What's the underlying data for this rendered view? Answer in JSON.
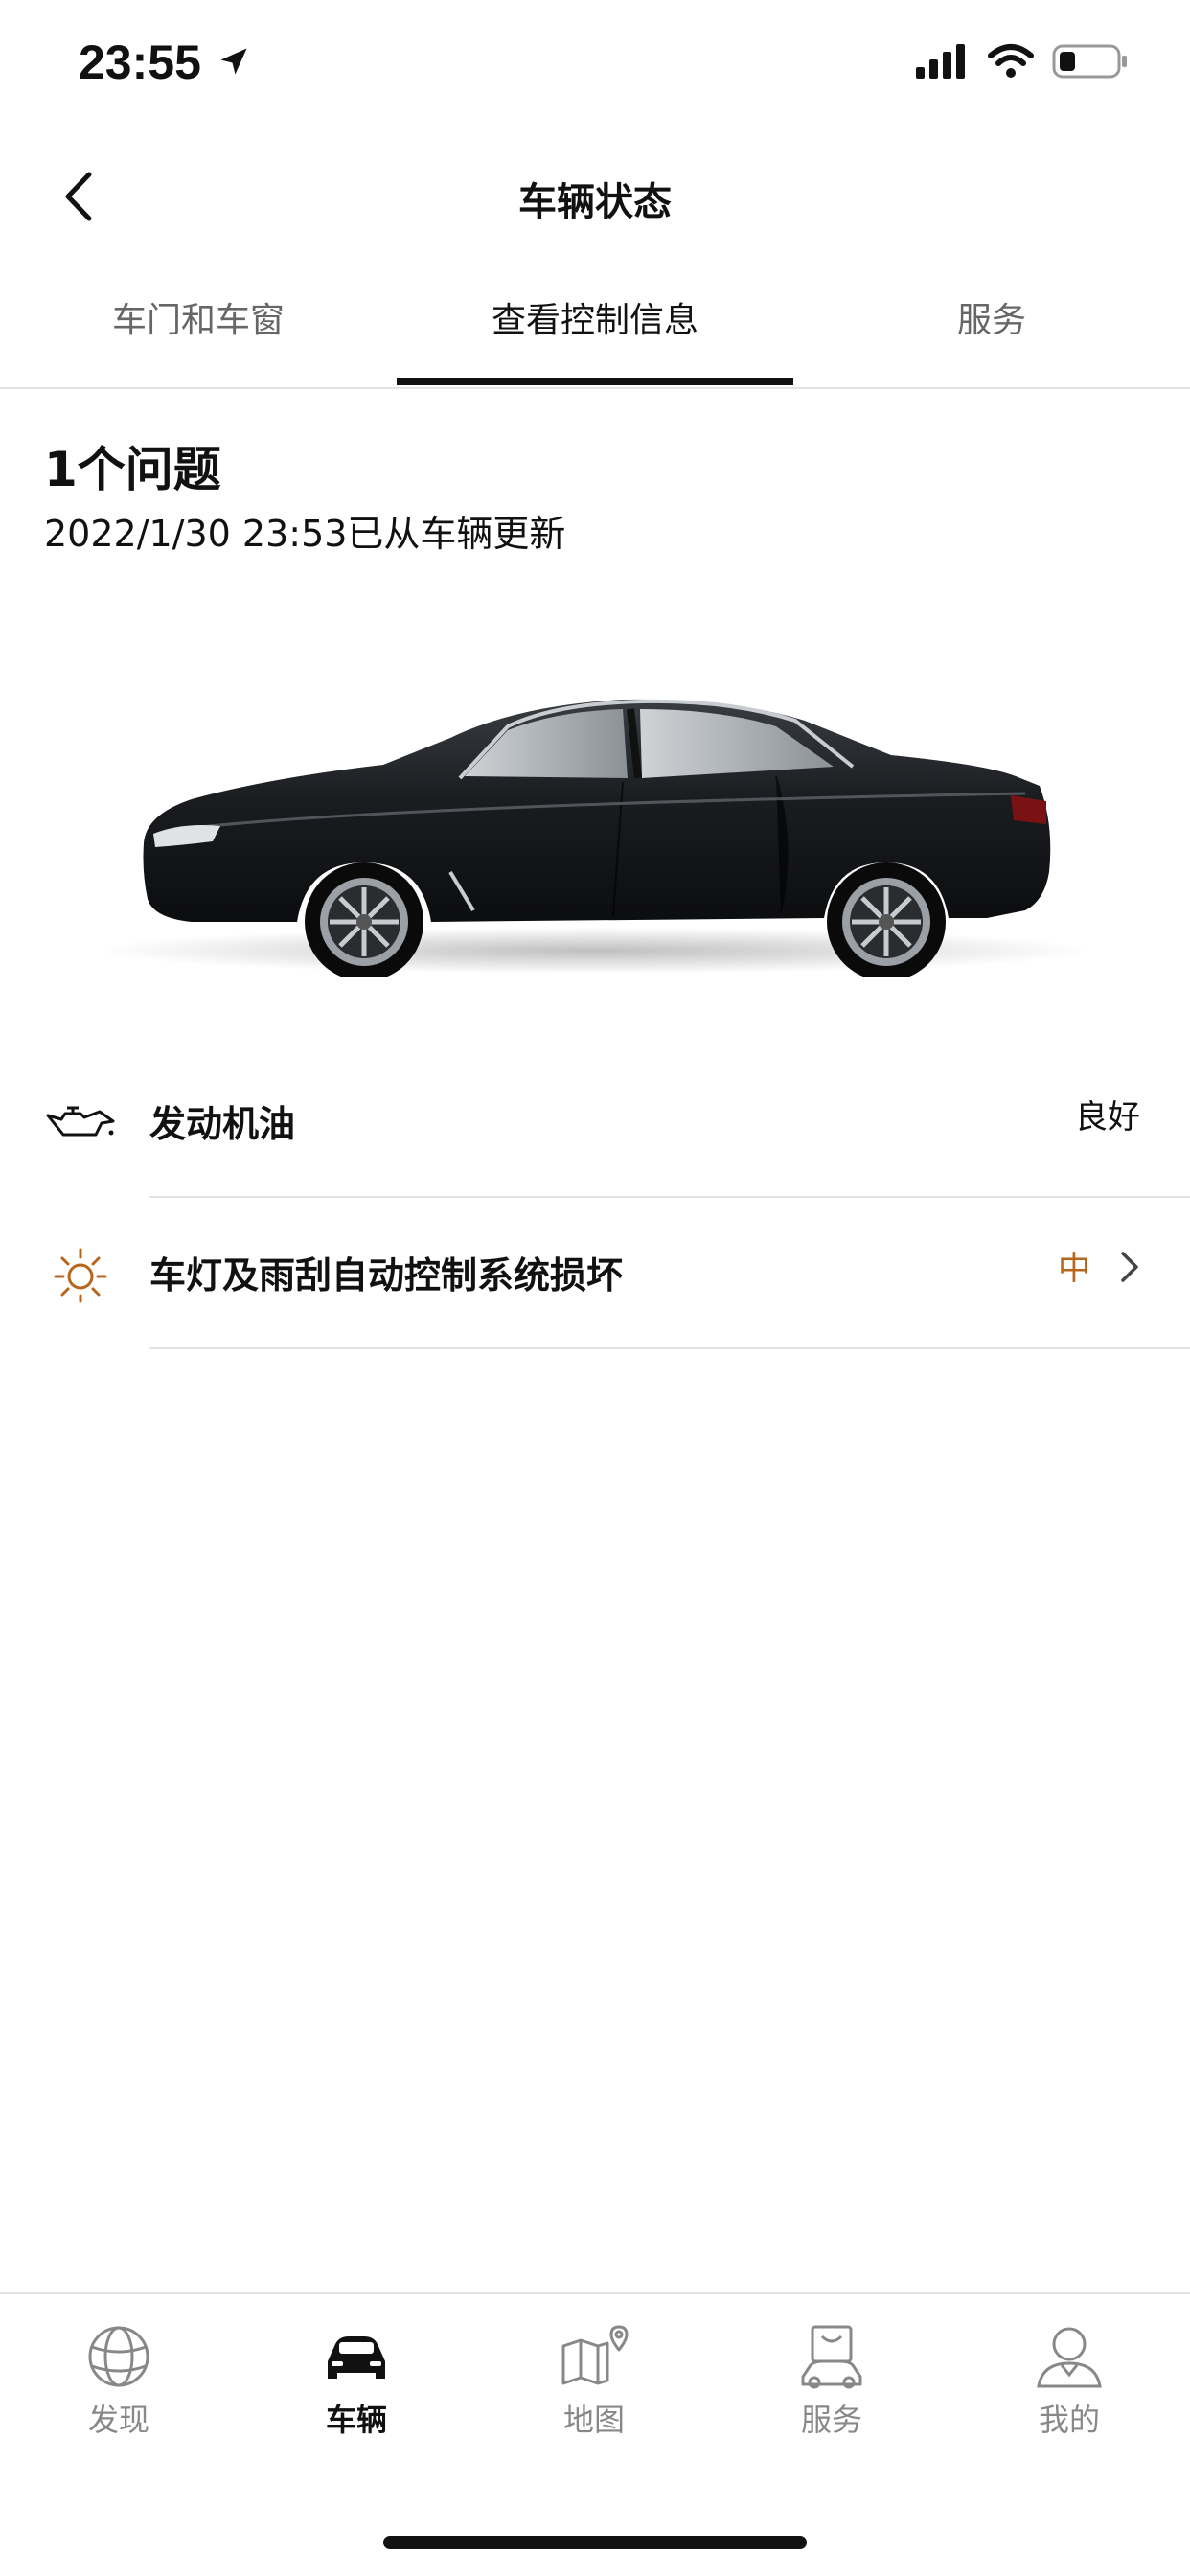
{
  "status_bar": {
    "time": "23:55"
  },
  "header": {
    "title": "车辆状态"
  },
  "tabs": [
    {
      "label": "车门和车窗"
    },
    {
      "label": "查看控制信息"
    },
    {
      "label": "服务"
    }
  ],
  "summary": {
    "issues": "1个问题",
    "updated": "2022/1/30 23:53已从车辆更新"
  },
  "items": [
    {
      "icon": "oil-can-icon",
      "label": "发动机油",
      "status": "良好",
      "status_color": "#111111"
    },
    {
      "icon": "light-bulb-icon",
      "label": "车灯及雨刮自动控制系统损坏",
      "status": "中",
      "status_color": "#b8651d"
    }
  ],
  "bottom_nav": [
    {
      "icon": "globe-icon",
      "label": "发现"
    },
    {
      "icon": "car-icon",
      "label": "车辆"
    },
    {
      "icon": "map-icon",
      "label": "地图"
    },
    {
      "icon": "shopping-bag-icon",
      "label": "服务"
    },
    {
      "icon": "user-icon",
      "label": "我的"
    }
  ],
  "colors": {
    "accent_warning": "#b8651d",
    "active_tab": "#111111",
    "divider": "#e3e3e3"
  }
}
